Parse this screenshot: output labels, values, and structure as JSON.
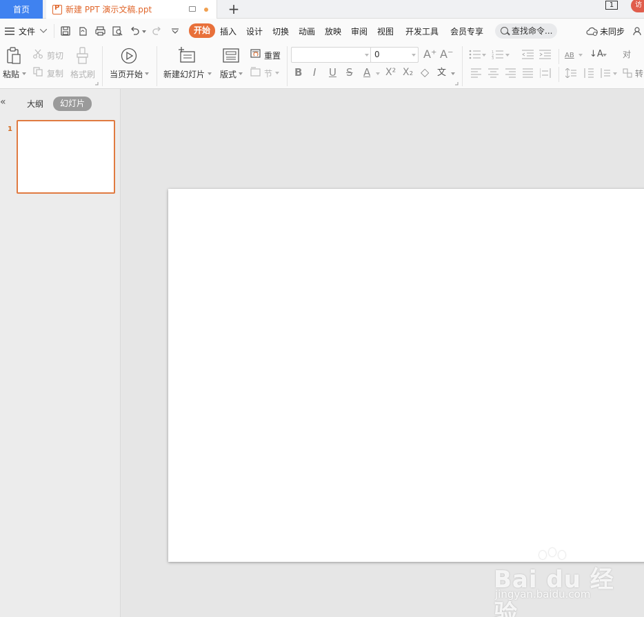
{
  "tabs": {
    "home": "首页",
    "document": "新建 PPT 演示文稿.ppt",
    "add": "+"
  },
  "window": {
    "page_indicator": "1",
    "avatar_text": "访"
  },
  "menu": {
    "file": "文件",
    "items": [
      "开始",
      "插入",
      "设计",
      "切换",
      "动画",
      "放映",
      "审阅",
      "视图",
      "开发工具",
      "会员专享"
    ],
    "search": "查找命令...",
    "sync": "未同步"
  },
  "ribbon": {
    "paste": "粘贴",
    "cut": "剪切",
    "copy": "复制",
    "format_painter": "格式刷",
    "from_current": "当页开始",
    "new_slide": "新建幻灯片",
    "layout": "版式",
    "reset": "重置",
    "section": "节",
    "font_name": "",
    "font_size": "0",
    "glyphs": {
      "grow": "A⁺",
      "shrink": "A⁻",
      "bold": "B",
      "italic": "I",
      "underline": "U",
      "strike": "S",
      "color": "A",
      "sup": "X²",
      "sub": "X₂",
      "clear": "◇",
      "phonetic": "文",
      "text_box": "AB",
      "sort": "↓A",
      "align_text": "对",
      "convert": "转"
    }
  },
  "panel": {
    "outline_tab": "大纲",
    "slides_tab": "幻灯片",
    "collapse": "«",
    "slide_number": "1"
  },
  "watermark": {
    "logo": "Bai  du 经验",
    "url": "jingyan.baidu.com"
  },
  "colors": {
    "accent": "#e8703a",
    "home_tab": "#3f82f0",
    "doc_title": "#e0662b"
  }
}
